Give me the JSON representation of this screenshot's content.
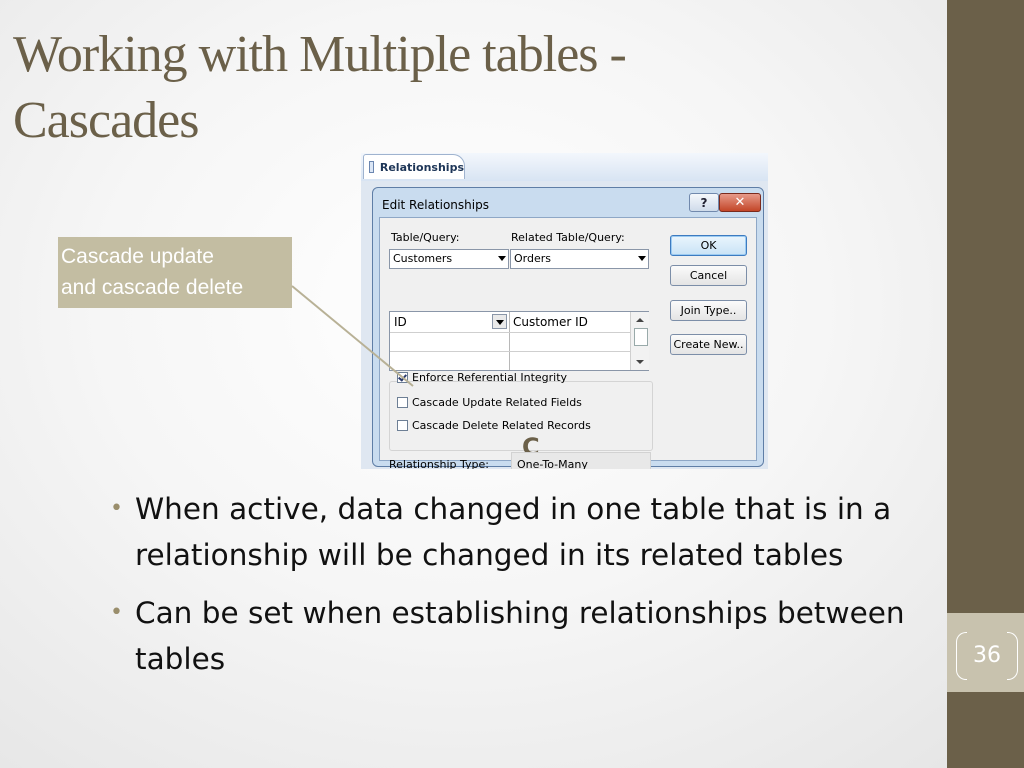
{
  "slide": {
    "title_line1": "Working with Multiple tables -",
    "title_line2": "Cascades",
    "callout_line1": "Cascade update",
    "callout_line2": "and cascade delete",
    "page_number": "36",
    "bullets": [
      {
        "line1": "When active, data changed in one table that is in a",
        "line2": "relationship will be changed in its related tables"
      },
      {
        "line1": "Can be set when establishing relationships between",
        "line2": "tables"
      }
    ],
    "colors": {
      "accent": "#6b6049",
      "callout_bg": "#c3bda2",
      "page_tab": "#c8c2ae"
    }
  },
  "ribbon": {
    "tab_label": "Relationships",
    "tab_icon": "relationships-icon"
  },
  "dialog": {
    "title": "Edit Relationships",
    "help_label": "?",
    "close_label": "✕",
    "table_query_label": "Table/Query:",
    "related_table_query_label": "Related Table/Query:",
    "table_query_value": "Customers",
    "related_table_query_value": "Orders",
    "field_left": "ID",
    "field_right": "Customer ID",
    "enforce_label": "Enforce Referential Integrity",
    "enforce_checked": true,
    "cascade_update_label": "Cascade Update Related Fields",
    "cascade_update_checked": false,
    "cascade_delete_label": "Cascade Delete Related Records",
    "cascade_delete_checked": false,
    "relationship_type_label": "Relationship Type:",
    "relationship_type_value": "One-To-Many",
    "buttons": {
      "ok": "OK",
      "cancel": "Cancel",
      "join_type": "Join Type..",
      "create_new": "Create New.."
    },
    "annotation_letter": "C"
  }
}
